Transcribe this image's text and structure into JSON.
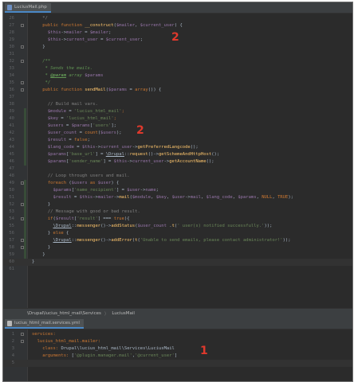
{
  "tabs": {
    "top": {
      "label": "LuciusMail.php",
      "icon": "php-file-icon"
    },
    "bottom": {
      "label": "lucius_html_mail.services.yml",
      "icon": "yaml-file-icon"
    }
  },
  "breadcrumb": [
    "\\Drupal\\lucius_html_mail\\Services",
    "LuciusMail"
  ],
  "annotations": [
    "2",
    "2",
    "1"
  ],
  "php_editor": [
    {
      "n": "26",
      "t": [
        [
          "c",
          "    */"
        ]
      ]
    },
    {
      "n": "27",
      "t": [
        [
          "k",
          "    public function "
        ],
        [
          "f",
          "__construct"
        ],
        [
          "p",
          "("
        ],
        [
          "v",
          "$mailer"
        ],
        [
          "p",
          ", "
        ],
        [
          "v",
          "$current_user"
        ],
        [
          "p",
          ") {"
        ]
      ]
    },
    {
      "n": "28",
      "t": [
        [
          "p",
          "      "
        ],
        [
          "v",
          "$this"
        ],
        [
          "p",
          "->"
        ],
        [
          "v",
          "mailer"
        ],
        [
          "p",
          " = "
        ],
        [
          "v",
          "$mailer"
        ],
        [
          "p",
          ";"
        ]
      ]
    },
    {
      "n": "29",
      "t": [
        [
          "p",
          "      "
        ],
        [
          "v",
          "$this"
        ],
        [
          "p",
          "->"
        ],
        [
          "v",
          "current_user"
        ],
        [
          "p",
          " = "
        ],
        [
          "v",
          "$current_user"
        ],
        [
          "p",
          ";"
        ]
      ]
    },
    {
      "n": "30",
      "t": [
        [
          "p",
          "    }"
        ]
      ]
    },
    {
      "n": "31",
      "t": []
    },
    {
      "n": "32",
      "t": [
        [
          "d",
          "    /**"
        ]
      ]
    },
    {
      "n": "33",
      "t": [
        [
          "d",
          "     * Sends the mails."
        ]
      ]
    },
    {
      "n": "34",
      "t": [
        [
          "d",
          "     * "
        ],
        [
          "dt",
          "@param"
        ],
        [
          "d",
          " array "
        ],
        [
          "v",
          "$params"
        ]
      ]
    },
    {
      "n": "35",
      "t": [
        [
          "d",
          "     */"
        ]
      ]
    },
    {
      "n": "36",
      "t": [
        [
          "k",
          "    public function "
        ],
        [
          "f",
          "sendMail"
        ],
        [
          "p",
          "("
        ],
        [
          "v",
          "$params"
        ],
        [
          "p",
          " = "
        ],
        [
          "k",
          "array"
        ],
        [
          "p",
          "()) {"
        ]
      ]
    },
    {
      "n": "37",
      "t": []
    },
    {
      "n": "38",
      "t": [
        [
          "c",
          "      // Build mail vars."
        ]
      ]
    },
    {
      "n": "39",
      "t": [
        [
          "p",
          "      "
        ],
        [
          "v",
          "$module"
        ],
        [
          "p",
          " = "
        ],
        [
          "s",
          "'lucius_html_mail'"
        ],
        [
          "k",
          ";"
        ]
      ]
    },
    {
      "n": "40",
      "t": [
        [
          "p",
          "      "
        ],
        [
          "v",
          "$key"
        ],
        [
          "p",
          " = "
        ],
        [
          "s",
          "'lucius_html_mail'"
        ],
        [
          "k",
          ";"
        ]
      ]
    },
    {
      "n": "41",
      "t": [
        [
          "p",
          "      "
        ],
        [
          "v",
          "$users"
        ],
        [
          "p",
          " = "
        ],
        [
          "v",
          "$params"
        ],
        [
          "p",
          "["
        ],
        [
          "s",
          "'users'"
        ],
        [
          "p",
          "];"
        ]
      ]
    },
    {
      "n": "42",
      "t": [
        [
          "p",
          "      "
        ],
        [
          "v",
          "$user_count"
        ],
        [
          "p",
          " = "
        ],
        [
          "k",
          "count"
        ],
        [
          "p",
          "("
        ],
        [
          "v",
          "$users"
        ],
        [
          "p",
          ");"
        ]
      ]
    },
    {
      "n": "43",
      "t": [
        [
          "p",
          "      "
        ],
        [
          "v",
          "$result"
        ],
        [
          "p",
          " = "
        ],
        [
          "k",
          "false"
        ],
        [
          "p",
          ";"
        ]
      ]
    },
    {
      "n": "44",
      "t": [
        [
          "p",
          "      "
        ],
        [
          "v",
          "$lang_code"
        ],
        [
          "p",
          " = "
        ],
        [
          "v",
          "$this"
        ],
        [
          "p",
          "->"
        ],
        [
          "v",
          "current_user"
        ],
        [
          "p",
          "->"
        ],
        [
          "f",
          "getPreferredLangcode"
        ],
        [
          "p",
          "();"
        ]
      ]
    },
    {
      "n": "45",
      "t": [
        [
          "p",
          "      "
        ],
        [
          "v",
          "$params"
        ],
        [
          "p",
          "["
        ],
        [
          "s",
          "'base_url'"
        ],
        [
          "p",
          "] = "
        ],
        [
          "u",
          "\\Drupal"
        ],
        [
          "p",
          "::"
        ],
        [
          "f",
          "request"
        ],
        [
          "p",
          "()->"
        ],
        [
          "f",
          "getSchemeAndHttpHost"
        ],
        [
          "p",
          "();"
        ]
      ]
    },
    {
      "n": "46",
      "t": [
        [
          "p",
          "      "
        ],
        [
          "v",
          "$params"
        ],
        [
          "p",
          "["
        ],
        [
          "s",
          "'sender_name'"
        ],
        [
          "p",
          "] = "
        ],
        [
          "v",
          "$this"
        ],
        [
          "p",
          "->"
        ],
        [
          "v",
          "current_user"
        ],
        [
          "p",
          "->"
        ],
        [
          "f",
          "getAccountName"
        ],
        [
          "p",
          "();"
        ]
      ]
    },
    {
      "n": "47",
      "t": []
    },
    {
      "n": "48",
      "t": [
        [
          "c",
          "      // Loop through users and mail."
        ]
      ]
    },
    {
      "n": "49",
      "t": [
        [
          "k",
          "      foreach "
        ],
        [
          "p",
          "("
        ],
        [
          "v",
          "$users"
        ],
        [
          "k",
          " as "
        ],
        [
          "v",
          "$user"
        ],
        [
          "p",
          ") {"
        ]
      ]
    },
    {
      "n": "50",
      "t": [
        [
          "p",
          "        "
        ],
        [
          "v",
          "$params"
        ],
        [
          "p",
          "["
        ],
        [
          "s",
          "'name_recipient'"
        ],
        [
          "p",
          "] = "
        ],
        [
          "v",
          "$user"
        ],
        [
          "p",
          "->"
        ],
        [
          "v",
          "name"
        ],
        [
          "p",
          ";"
        ]
      ]
    },
    {
      "n": "51",
      "t": [
        [
          "p",
          "        "
        ],
        [
          "v",
          "$result"
        ],
        [
          "p",
          " = "
        ],
        [
          "v",
          "$this"
        ],
        [
          "p",
          "->"
        ],
        [
          "v",
          "mailer"
        ],
        [
          "p",
          "->"
        ],
        [
          "f",
          "mail"
        ],
        [
          "p",
          "("
        ],
        [
          "v",
          "$module"
        ],
        [
          "p",
          ", "
        ],
        [
          "v",
          "$key"
        ],
        [
          "p",
          ", "
        ],
        [
          "v",
          "$user"
        ],
        [
          "p",
          "->"
        ],
        [
          "v",
          "mail"
        ],
        [
          "p",
          ", "
        ],
        [
          "v",
          "$lang_code"
        ],
        [
          "p",
          ", "
        ],
        [
          "v",
          "$params"
        ],
        [
          "p",
          ", "
        ],
        [
          "k",
          "NULL"
        ],
        [
          "p",
          ", "
        ],
        [
          "k",
          "TRUE"
        ],
        [
          "p",
          ");"
        ]
      ]
    },
    {
      "n": "52",
      "t": [
        [
          "p",
          "      }"
        ]
      ]
    },
    {
      "n": "53",
      "t": [
        [
          "c",
          "      // Message with good or bad result."
        ]
      ]
    },
    {
      "n": "54",
      "t": [
        [
          "k",
          "      if"
        ],
        [
          "p",
          "("
        ],
        [
          "v",
          "$result"
        ],
        [
          "p",
          "["
        ],
        [
          "s",
          "'result'"
        ],
        [
          "p",
          "] === "
        ],
        [
          "k",
          "true"
        ],
        [
          "p",
          "){"
        ]
      ]
    },
    {
      "n": "55",
      "t": [
        [
          "p",
          "        "
        ],
        [
          "u",
          "\\Drupal"
        ],
        [
          "p",
          "::"
        ],
        [
          "f",
          "messenger"
        ],
        [
          "p",
          "()->"
        ],
        [
          "f",
          "addStatus"
        ],
        [
          "p",
          "("
        ],
        [
          "v",
          "$user_count"
        ],
        [
          "p",
          " ."
        ],
        [
          "f",
          "t"
        ],
        [
          "p",
          "("
        ],
        [
          "s",
          "' user(s) notified successfully.'"
        ],
        [
          "p",
          "));"
        ]
      ]
    },
    {
      "n": "56",
      "t": [
        [
          "p",
          "      } "
        ],
        [
          "k",
          "else"
        ],
        [
          "p",
          " {"
        ]
      ]
    },
    {
      "n": "57",
      "t": [
        [
          "p",
          "        "
        ],
        [
          "u",
          "\\Drupal"
        ],
        [
          "p",
          "::"
        ],
        [
          "f",
          "messenger"
        ],
        [
          "p",
          "()->"
        ],
        [
          "f",
          "addError"
        ],
        [
          "p",
          "("
        ],
        [
          "f",
          "t"
        ],
        [
          "p",
          "("
        ],
        [
          "s",
          "'Unable to send emails, please contact administrator!'"
        ],
        [
          "p",
          "));"
        ]
      ]
    },
    {
      "n": "58",
      "t": [
        [
          "p",
          "      }"
        ]
      ]
    },
    {
      "n": "59",
      "t": [
        [
          "p",
          "    }"
        ]
      ]
    },
    {
      "n": "60",
      "t": [
        [
          "p",
          "}"
        ]
      ]
    },
    {
      "n": "61",
      "t": []
    }
  ],
  "yaml_editor": [
    {
      "n": "1",
      "t": [
        [
          "ya",
          "services:"
        ]
      ]
    },
    {
      "n": "2",
      "t": [
        [
          "ya",
          "  lucius_html_mail.mailer:"
        ]
      ]
    },
    {
      "n": "3",
      "t": [
        [
          "ya",
          "    class: "
        ],
        [
          "p",
          "Drupal\\lucius_html_mail\\Services\\LuciusMail"
        ]
      ]
    },
    {
      "n": "4",
      "t": [
        [
          "ya",
          "    arguments: "
        ],
        [
          "p",
          "["
        ],
        [
          "ys",
          "'@plugin.manager.mail'"
        ],
        [
          "p",
          ","
        ],
        [
          "ys",
          "'@current_user'"
        ],
        [
          "p",
          "]"
        ]
      ]
    },
    {
      "n": "5",
      "t": []
    }
  ],
  "colors": {
    "background": "#2b2b2b",
    "keyword": "#cc7832",
    "string": "#6a8759",
    "variable": "#9876aa",
    "function": "#ffc66d",
    "annotation": "#e0392c"
  }
}
